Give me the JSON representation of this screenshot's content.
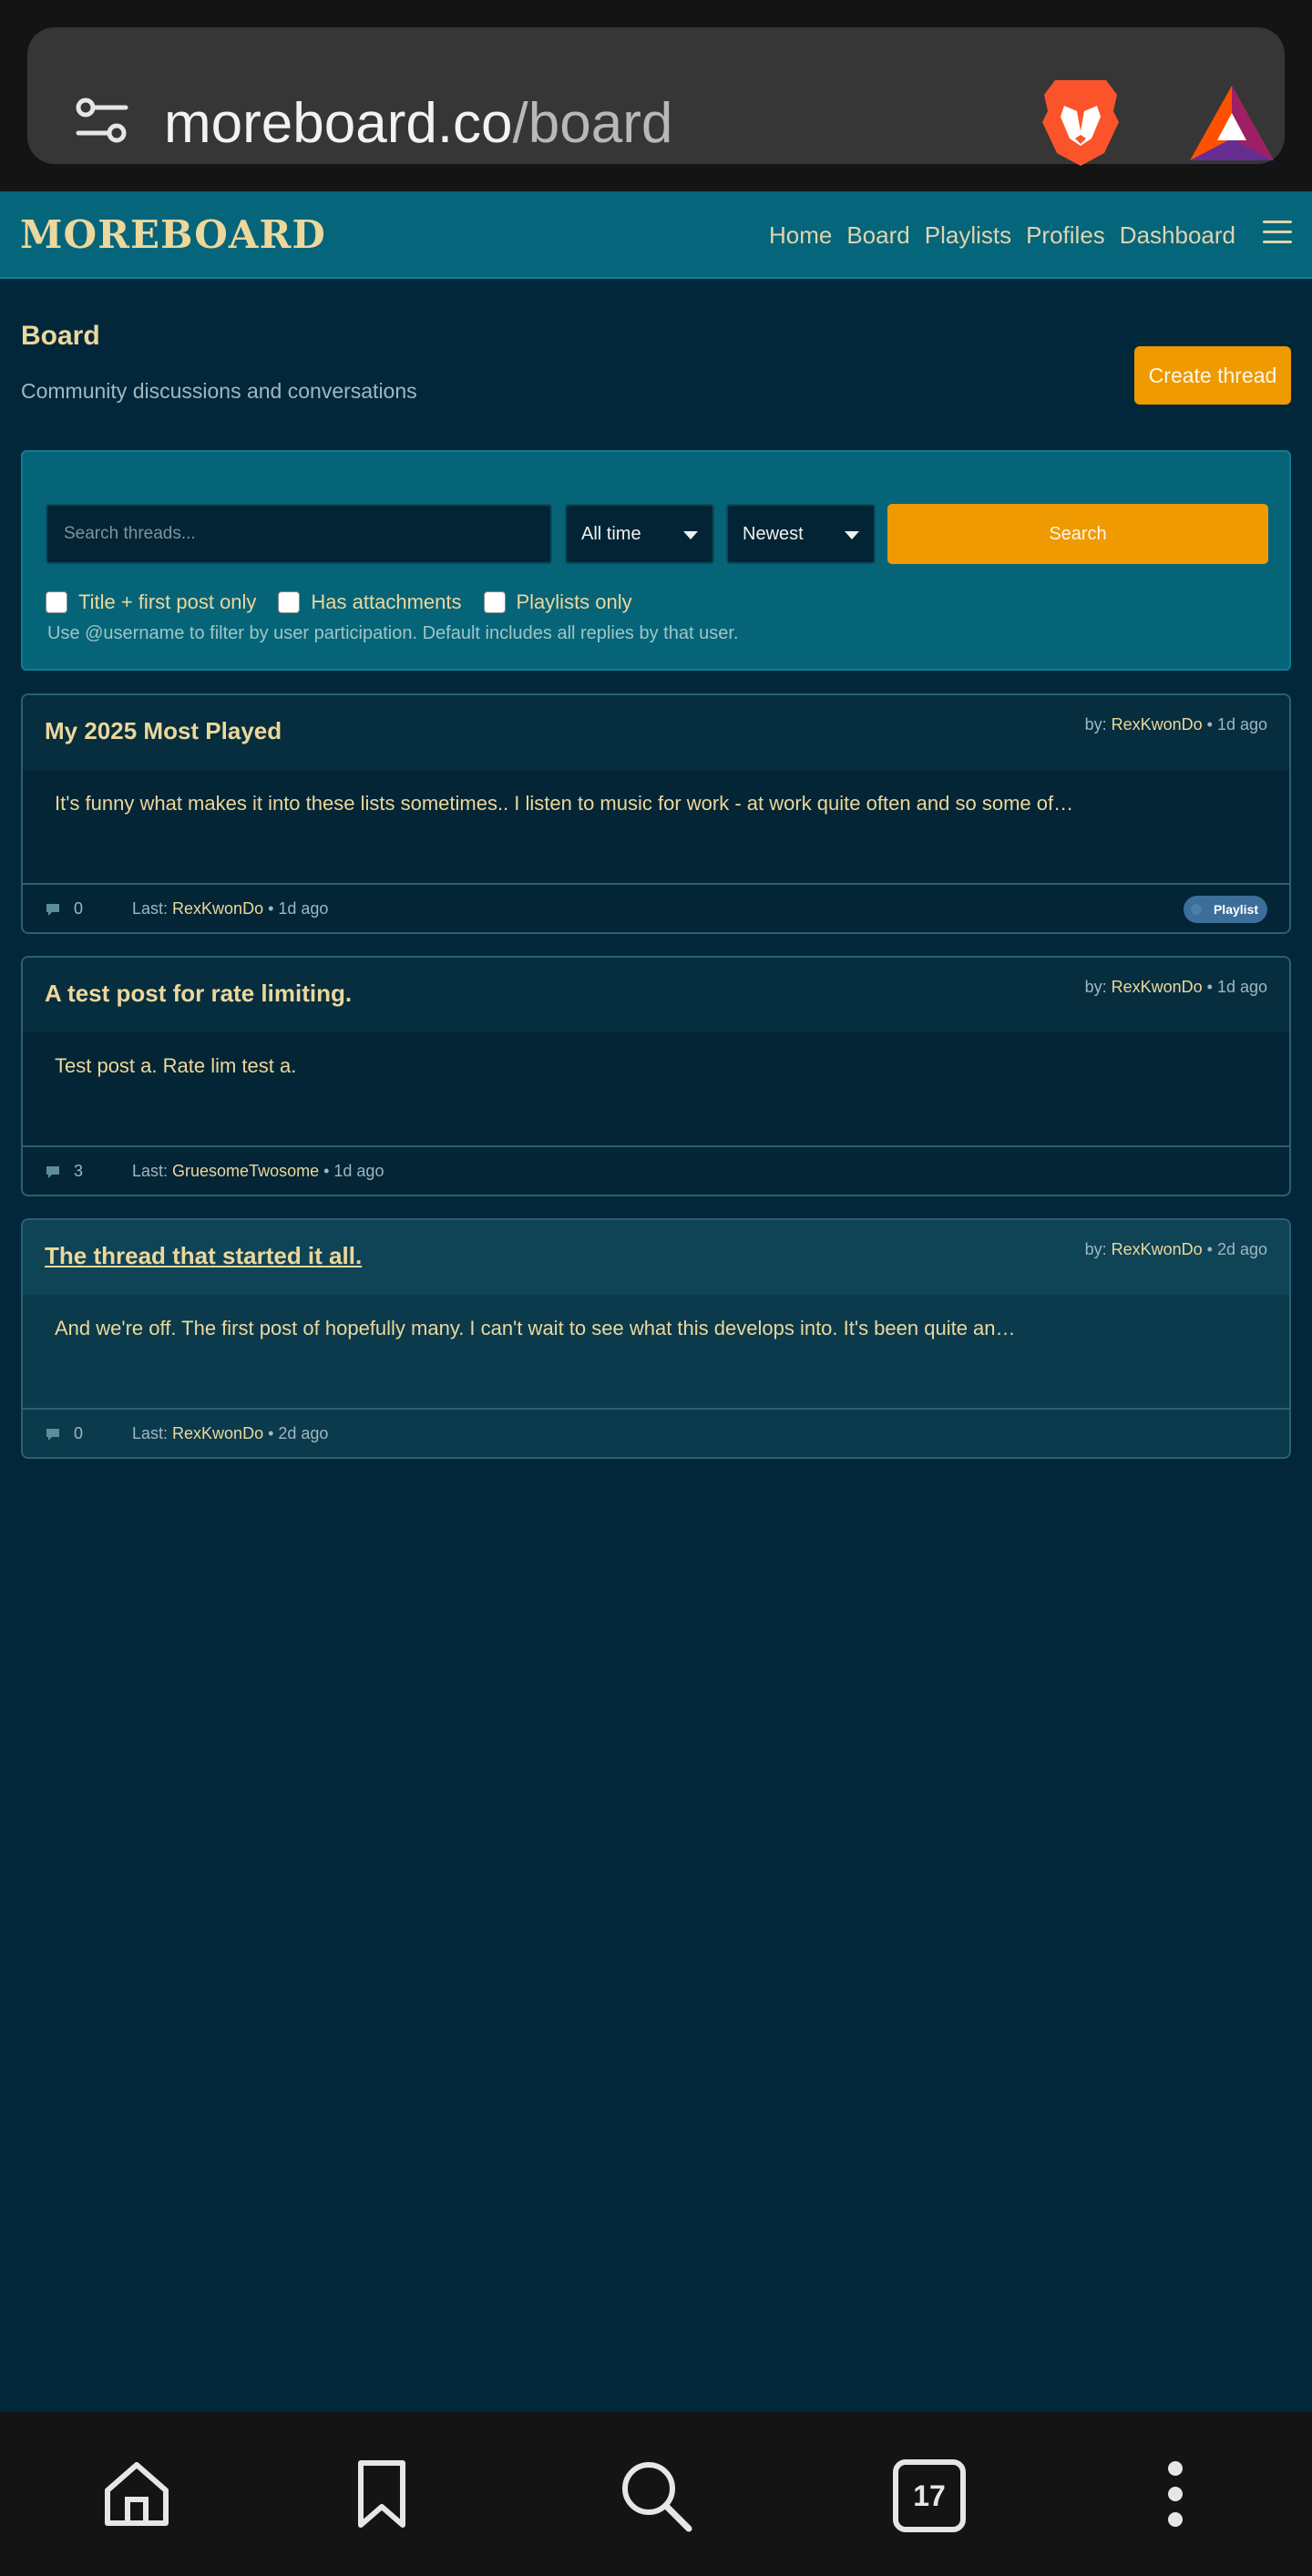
{
  "browser": {
    "url_domain": "moreboard.co",
    "url_path": "/board",
    "icons": [
      "tune-icon",
      "brave-lion-icon",
      "bat-triangle-icon"
    ]
  },
  "site": {
    "logo": "MOREBOARD",
    "nav": [
      "Home",
      "Board",
      "Playlists",
      "Profiles",
      "Dashboard"
    ],
    "menu_icon": "hamburger-icon"
  },
  "page": {
    "title": "Board",
    "subtitle": "Community discussions and conversations",
    "create_label": "Create thread"
  },
  "filters": {
    "search_placeholder": "Search threads...",
    "time_value": "All time",
    "sort_value": "Newest",
    "search_label": "Search",
    "checkboxes": [
      "Title + first post only",
      "Has attachments",
      "Playlists only"
    ],
    "hint": "Use @username to filter by user participation. Default includes all replies by that user."
  },
  "threads": [
    {
      "title": "My 2025 Most Played",
      "by_prefix": "by: ",
      "author": "RexKwonDo",
      "age": " • 1d ago",
      "excerpt": "It's funny what makes it into these lists sometimes.. I listen to music for work - at work quite often and so some of…",
      "replies": "0",
      "last_prefix": "Last: ",
      "last_user": "RexKwonDo",
      "last_age": " • 1d ago",
      "tag": "Playlist"
    },
    {
      "title": "A test post for rate limiting.",
      "by_prefix": "by: ",
      "author": "RexKwonDo",
      "age": " • 1d ago",
      "excerpt": "Test post a. Rate lim test a.",
      "replies": "3",
      "last_prefix": "Last: ",
      "last_user": "GruesomeTwosome",
      "last_age": " • 1d ago"
    },
    {
      "title": "The thread that started it all.",
      "by_prefix": "by: ",
      "author": "RexKwonDo",
      "age": " • 2d ago",
      "excerpt": "And we're off. The first post of hopefully many. I can't wait to see what this develops into. It's been quite an…",
      "replies": "0",
      "last_prefix": "Last: ",
      "last_user": "RexKwonDo",
      "last_age": " • 2d ago"
    }
  ],
  "bottom_bar": {
    "tab_count": "17",
    "icons": [
      "home-icon",
      "bookmark-icon",
      "search-icon",
      "tabs-icon",
      "more-icon"
    ]
  },
  "colors": {
    "background": "#03273a",
    "nav": "#05657a",
    "accent": "#ee9a00",
    "gold_text": "#ecd79c",
    "tag": "#3c6e9a"
  }
}
